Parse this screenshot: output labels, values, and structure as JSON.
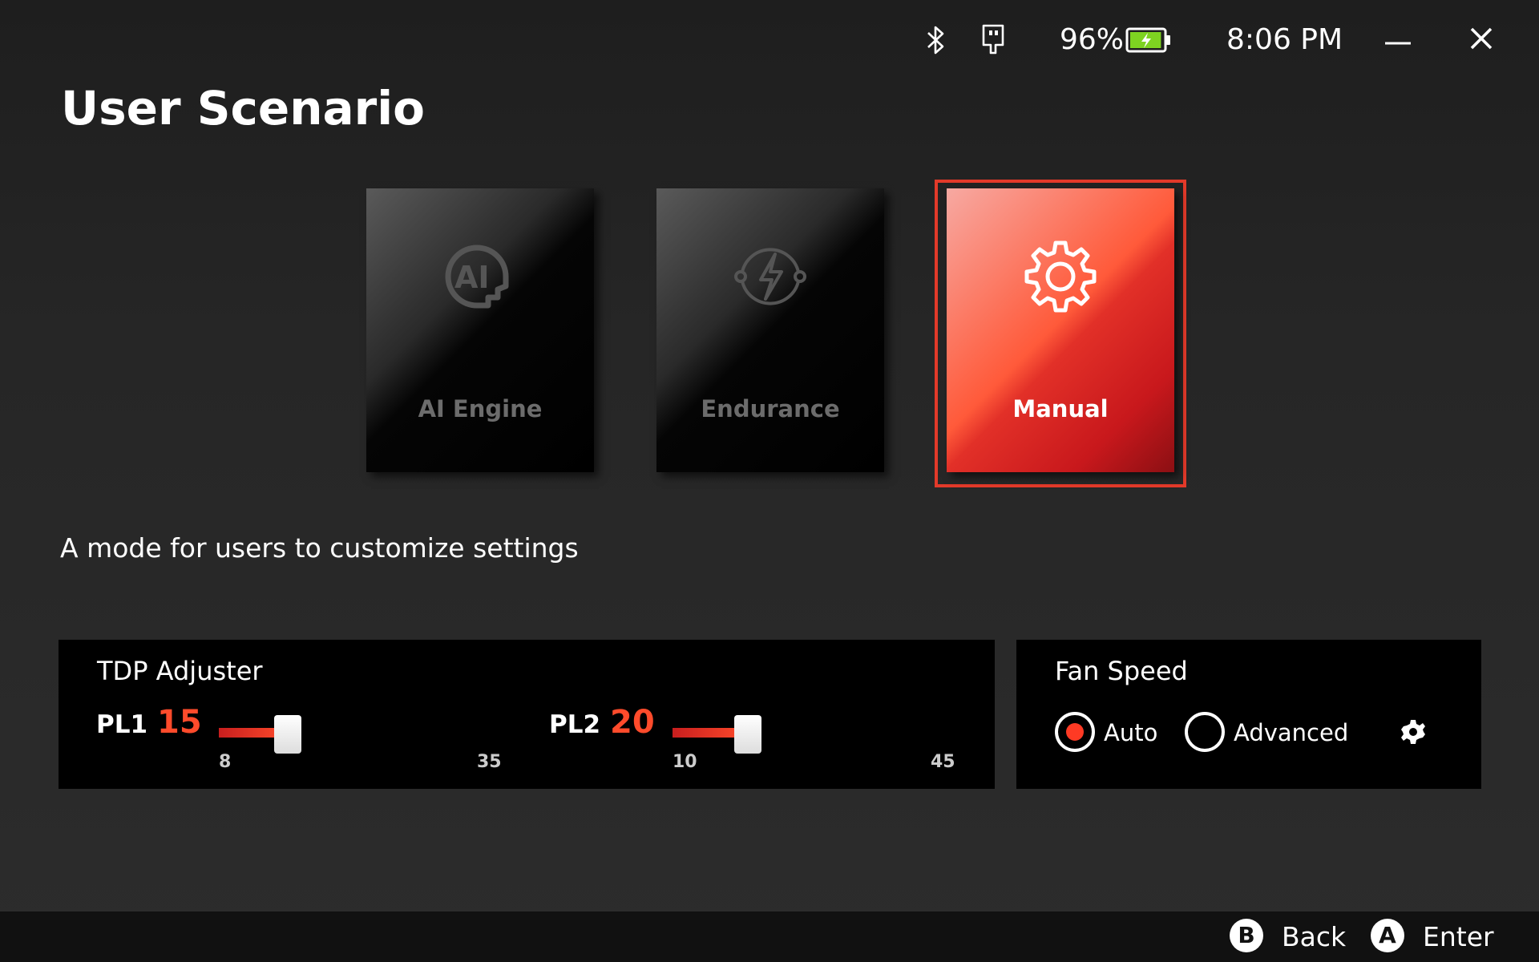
{
  "status": {
    "battery_percent": "96%",
    "battery_level": 0.96,
    "time": "8:06 PM",
    "icons": [
      "bluetooth-icon",
      "usb-icon",
      "battery-charging-icon",
      "minimize-icon",
      "close-icon"
    ]
  },
  "page": {
    "title": "User Scenario",
    "description": "A mode for users to customize settings"
  },
  "modes": [
    {
      "label": "AI Engine",
      "icon": "ai-engine-icon",
      "selected": false
    },
    {
      "label": "Endurance",
      "icon": "endurance-icon",
      "selected": false
    },
    {
      "label": "Manual",
      "icon": "gear-icon",
      "selected": true
    }
  ],
  "tdp": {
    "title": "TDP Adjuster",
    "pl1": {
      "label": "PL1",
      "value": "15",
      "min": "8",
      "max": "35",
      "num": 15,
      "nmin": 8,
      "nmax": 35
    },
    "pl2": {
      "label": "PL2",
      "value": "20",
      "min": "10",
      "max": "45",
      "num": 20,
      "nmin": 10,
      "nmax": 45
    }
  },
  "fan": {
    "title": "Fan Speed",
    "options": [
      {
        "label": "Auto",
        "selected": true
      },
      {
        "label": "Advanced",
        "selected": false
      }
    ]
  },
  "footer": {
    "back_key": "B",
    "back_label": "Back",
    "enter_key": "A",
    "enter_label": "Enter"
  },
  "colors": {
    "accent": "#ff4b2b",
    "selected_frame": "#e33a2a",
    "battery_fill": "#7ed321"
  }
}
